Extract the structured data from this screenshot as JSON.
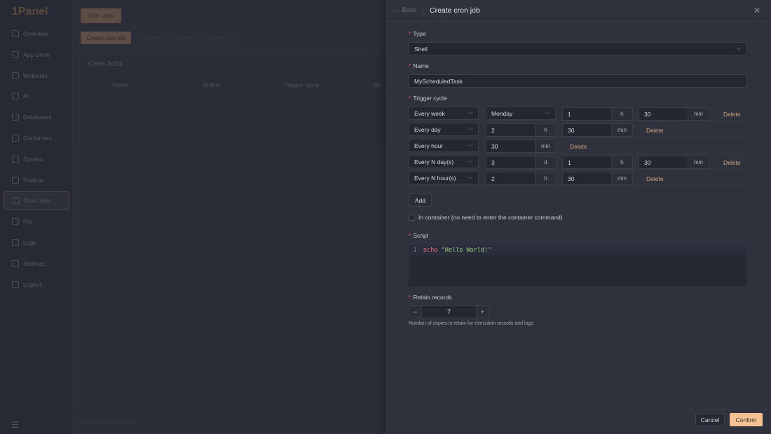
{
  "app": {
    "logo": "1Panel",
    "tab": "Cron Jobs",
    "create_button": "Create cron job",
    "toolbar": [
      "Enable",
      "Disable",
      "Delete"
    ],
    "panel_title": "Cron Jobs",
    "columns": [
      "Name",
      "Status",
      "Trigger cycle",
      "Re"
    ],
    "copyright": "Copyright © 2025 Lingxia"
  },
  "sidebar": {
    "items": [
      {
        "label": "Overview",
        "icon": "home-icon"
      },
      {
        "label": "App Store",
        "icon": "grid-icon"
      },
      {
        "label": "Websites",
        "icon": "globe-icon",
        "chevron": true
      },
      {
        "label": "AI",
        "icon": "robot-icon",
        "chevron": true
      },
      {
        "label": "Databases",
        "icon": "database-icon"
      },
      {
        "label": "Containers",
        "icon": "docker-icon"
      },
      {
        "label": "System",
        "icon": "server-icon",
        "chevron": true
      },
      {
        "label": "Toolbox",
        "icon": "toolbox-icon"
      },
      {
        "label": "Cron Jobs",
        "icon": "calendar-icon",
        "active": true
      },
      {
        "label": "Pro",
        "icon": "diamond-icon",
        "chevron": true
      },
      {
        "label": "Logs",
        "icon": "log-icon"
      },
      {
        "label": "Settings",
        "icon": "gear-icon"
      },
      {
        "label": "Logout",
        "icon": "logout-icon"
      }
    ]
  },
  "drawer": {
    "back": "Back",
    "title": "Create cron job",
    "type_label": "Type",
    "type_value": "Shell",
    "name_label": "Name",
    "name_value": "MyScheduledTask",
    "trigger_label": "Trigger cycle",
    "triggers": [
      {
        "cycle": "Every week",
        "weekday": "Monday",
        "fields": [
          {
            "value": "1",
            "unit": "h"
          },
          {
            "value": "30",
            "unit": "min"
          }
        ]
      },
      {
        "cycle": "Every day",
        "fields": [
          {
            "value": "2",
            "unit": "h"
          },
          {
            "value": "30",
            "unit": "min"
          }
        ]
      },
      {
        "cycle": "Every hour",
        "fields": [
          {
            "value": "30",
            "unit": "min"
          }
        ]
      },
      {
        "cycle": "Every N day(s)",
        "fields": [
          {
            "value": "3",
            "unit": "d"
          },
          {
            "value": "1",
            "unit": "h"
          },
          {
            "value": "30",
            "unit": "min"
          }
        ]
      },
      {
        "cycle": "Every N hour(s)",
        "fields": [
          {
            "value": "2",
            "unit": "h"
          },
          {
            "value": "30",
            "unit": "min"
          }
        ]
      }
    ],
    "delete_label": "Delete",
    "add_label": "Add",
    "container_label": "In container (no need to enter the container command)",
    "script_label": "Script",
    "script_line_no": "1",
    "script_keyword": "echo",
    "script_string": "\"Hello World!\"",
    "retain_label": "Retain records",
    "retain_value": "7",
    "retain_help": "Number of copies to retain for execution records and logs",
    "cancel": "Cancel",
    "confirm": "Confirm"
  },
  "colors": {
    "accent": "#f5c193",
    "required": "#d9534f",
    "delete": "#d2a27f"
  }
}
